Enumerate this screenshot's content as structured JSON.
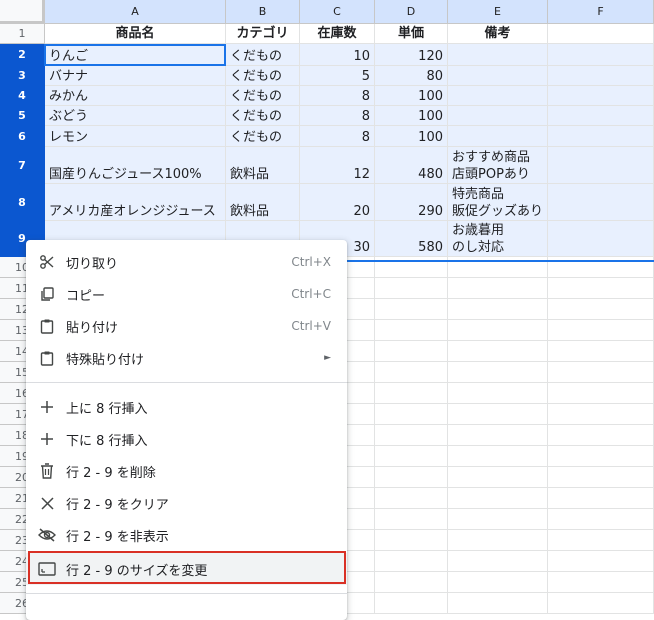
{
  "columns": [
    "A",
    "B",
    "C",
    "D",
    "E",
    "F"
  ],
  "rows": [
    {
      "num": "1",
      "cells": [
        "商品名",
        "カテゴリ",
        "在庫数",
        "単価",
        "備考",
        ""
      ]
    },
    {
      "num": "2",
      "cells": [
        "りんご",
        "くだもの",
        "10",
        "120",
        "",
        ""
      ]
    },
    {
      "num": "3",
      "cells": [
        "バナナ",
        "くだもの",
        "5",
        "80",
        "",
        ""
      ]
    },
    {
      "num": "4",
      "cells": [
        "みかん",
        "くだもの",
        "8",
        "100",
        "",
        ""
      ]
    },
    {
      "num": "5",
      "cells": [
        "ぶどう",
        "くだもの",
        "8",
        "100",
        "",
        ""
      ]
    },
    {
      "num": "6",
      "cells": [
        "レモン",
        "くだもの",
        "8",
        "100",
        "",
        ""
      ]
    },
    {
      "num": "7",
      "cells": [
        "国産りんごジュース100%",
        "飲料品",
        "12",
        "480",
        "おすすめ商品\n店頭POPあり",
        ""
      ]
    },
    {
      "num": "8",
      "cells": [
        "アメリカ産オレンジジュース",
        "飲料品",
        "20",
        "290",
        "特売商品\n販促グッズあり",
        ""
      ]
    },
    {
      "num": "9",
      "cells": [
        "",
        "",
        "30",
        "580",
        "お歳暮用\nのし対応",
        ""
      ]
    },
    {
      "num": "10",
      "cells": [
        "",
        "",
        "",
        "",
        "",
        ""
      ]
    },
    {
      "num": "11",
      "cells": [
        "",
        "",
        "",
        "",
        "",
        ""
      ]
    },
    {
      "num": "12",
      "cells": [
        "",
        "",
        "",
        "",
        "",
        ""
      ]
    },
    {
      "num": "13",
      "cells": [
        "",
        "",
        "",
        "",
        "",
        ""
      ]
    },
    {
      "num": "14",
      "cells": [
        "",
        "",
        "",
        "",
        "",
        ""
      ]
    },
    {
      "num": "15",
      "cells": [
        "",
        "",
        "",
        "",
        "",
        ""
      ]
    },
    {
      "num": "16",
      "cells": [
        "",
        "",
        "",
        "",
        "",
        ""
      ]
    },
    {
      "num": "17",
      "cells": [
        "",
        "",
        "",
        "",
        "",
        ""
      ]
    },
    {
      "num": "18",
      "cells": [
        "",
        "",
        "",
        "",
        "",
        ""
      ]
    },
    {
      "num": "19",
      "cells": [
        "",
        "",
        "",
        "",
        "",
        ""
      ]
    },
    {
      "num": "20",
      "cells": [
        "",
        "",
        "",
        "",
        "",
        ""
      ]
    },
    {
      "num": "21",
      "cells": [
        "",
        "",
        "",
        "",
        "",
        ""
      ]
    },
    {
      "num": "22",
      "cells": [
        "",
        "",
        "",
        "",
        "",
        ""
      ]
    },
    {
      "num": "23",
      "cells": [
        "",
        "",
        "",
        "",
        "",
        ""
      ]
    },
    {
      "num": "24",
      "cells": [
        "",
        "",
        "",
        "",
        "",
        ""
      ]
    },
    {
      "num": "25",
      "cells": [
        "",
        "",
        "",
        "",
        "",
        ""
      ]
    },
    {
      "num": "26",
      "cells": [
        "",
        "",
        "",
        "",
        "",
        ""
      ]
    }
  ],
  "menu": {
    "cut": {
      "label": "切り取り",
      "shortcut": "Ctrl+X",
      "icon": "scissors-icon"
    },
    "copy": {
      "label": "コピー",
      "shortcut": "Ctrl+C",
      "icon": "copy-icon"
    },
    "paste": {
      "label": "貼り付け",
      "shortcut": "Ctrl+V",
      "icon": "clipboard-icon"
    },
    "paste_special": {
      "label": "特殊貼り付け",
      "arrow": "►",
      "icon": "clipboard-icon"
    },
    "insert_above": {
      "label": "上に 8 行挿入",
      "icon": "plus-icon"
    },
    "insert_below": {
      "label": "下に 8 行挿入",
      "icon": "plus-icon"
    },
    "delete_rows": {
      "label": "行 2 - 9 を削除",
      "icon": "trash-icon"
    },
    "clear_rows": {
      "label": "行 2 - 9 をクリア",
      "icon": "x-icon"
    },
    "hide_rows": {
      "label": "行 2 - 9 を非表示",
      "icon": "eye-off-icon"
    },
    "resize_rows": {
      "label": "行 2 - 9 のサイズを変更",
      "icon": "resize-icon"
    }
  },
  "colors": {
    "selection": "#e8f0fe",
    "header_selected": "#0b57d0",
    "highlight_box": "#d93025"
  }
}
